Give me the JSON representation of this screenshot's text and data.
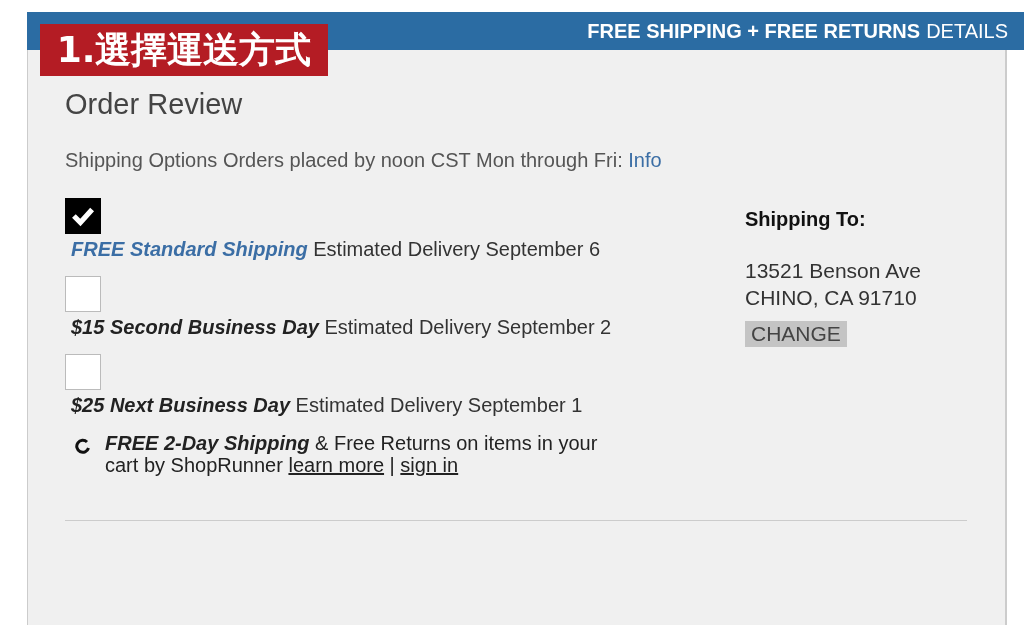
{
  "overlay_label": "1.選擇運送方式",
  "banner": {
    "highlight": "FREE SHIPPING + FREE RETURNS",
    "link": "DETAILS"
  },
  "title": "Order Review",
  "shipping_options_note": {
    "text": "Shipping Options Orders placed by noon CST Mon through Fri:",
    "link": "Info"
  },
  "options": [
    {
      "name": "FREE Standard Shipping",
      "delivery": "Estimated Delivery September 6",
      "checked": true
    },
    {
      "name": "$15 Second Business Day",
      "delivery": "Estimated Delivery September 2",
      "checked": false
    },
    {
      "name": "$25 Next Business Day",
      "delivery": "Estimated Delivery September 1",
      "checked": false
    }
  ],
  "shoprunner": {
    "name": "FREE 2-Day Shipping",
    "text": "& Free Returns on items in your cart by ShopRunner",
    "links": [
      "learn more",
      "sign in"
    ],
    "separator": "|"
  },
  "shipping_to": {
    "heading": "Shipping To:",
    "address": [
      "13521 Benson Ave",
      "CHINO, CA 91710"
    ],
    "button": "CHANGE"
  }
}
